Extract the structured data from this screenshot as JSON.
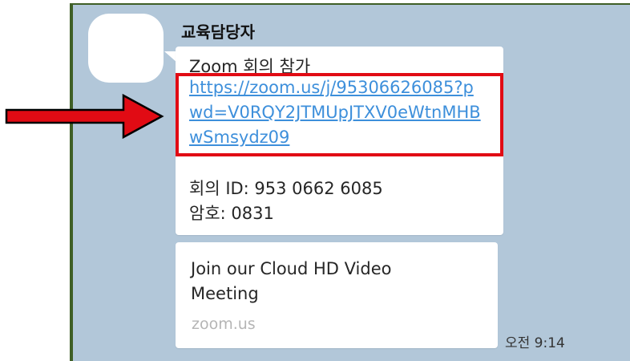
{
  "sender": {
    "name": "교육담당자"
  },
  "message": {
    "title": "Zoom 회의 참가",
    "link": "https://zoom.us/j/95306626085?pwd=V0RQY2JTMUpJTXV0eWtnMHBwSmsydz09",
    "meeting_id": "회의 ID: 953 0662 6085",
    "passcode": "암호: 0831"
  },
  "preview": {
    "title": "Join our Cloud HD Video Meeting",
    "domain": "zoom.us"
  },
  "timestamp": "오전 9:14",
  "colors": {
    "chat_background": "#b2c7d9",
    "link": "#3d8fdb",
    "highlight": "#e10b14"
  },
  "icons": {
    "annotation_arrow": "right-arrow-icon"
  }
}
